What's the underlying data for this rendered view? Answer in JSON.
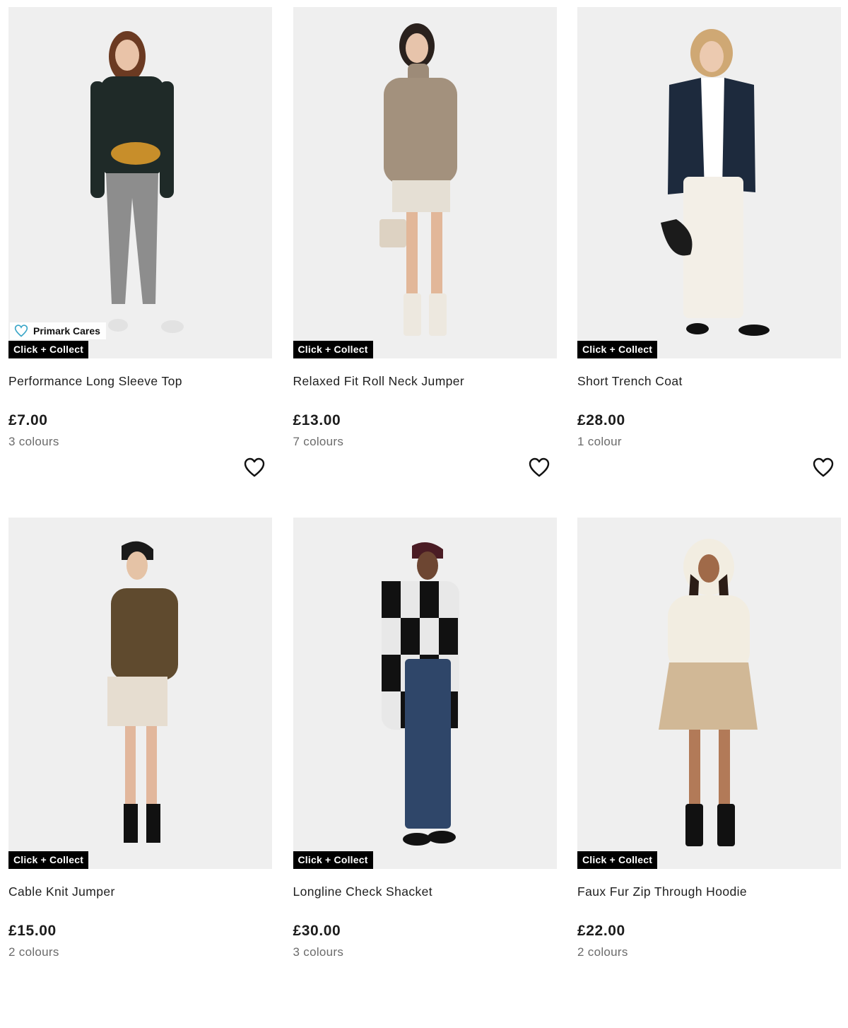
{
  "products": [
    {
      "title": "Performance Long Sleeve Top",
      "price": "£7.00",
      "colours": "3 colours",
      "badge": "Click + Collect",
      "cares": "Primark Cares"
    },
    {
      "title": "Relaxed Fit Roll Neck Jumper",
      "price": "£13.00",
      "colours": "7 colours",
      "badge": "Click + Collect"
    },
    {
      "title": "Short Trench Coat",
      "price": "£28.00",
      "colours": "1 colour",
      "badge": "Click + Collect"
    },
    {
      "title": "Cable Knit Jumper",
      "price": "£15.00",
      "colours": "2 colours",
      "badge": "Click + Collect"
    },
    {
      "title": "Longline Check Shacket",
      "price": "£30.00",
      "colours": "3 colours",
      "badge": "Click + Collect"
    },
    {
      "title": "Faux Fur Zip Through Hoodie",
      "price": "£22.00",
      "colours": "2 colours",
      "badge": "Click + Collect"
    }
  ],
  "icons": {
    "wishlist": "heart-outline-icon",
    "cares": "heart-icon"
  },
  "colors": {
    "badge_bg": "#000000",
    "image_bg": "#efefef",
    "cares_heart": "#3aa6c8"
  }
}
